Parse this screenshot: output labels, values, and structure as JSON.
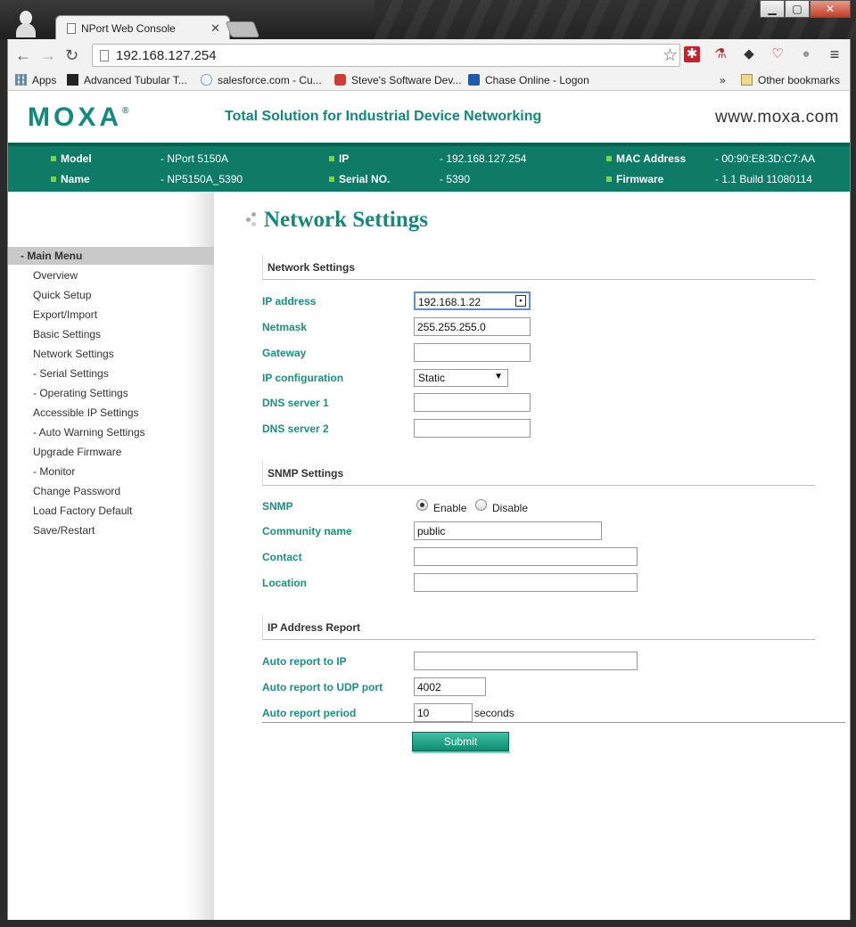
{
  "browser": {
    "tab_title": "NPort Web Console",
    "tab_close": "✕",
    "url": "192.168.127.254",
    "bookmarks": [
      {
        "label": "Apps"
      },
      {
        "label": "Advanced Tubular T..."
      },
      {
        "label": "salesforce.com - Cu..."
      },
      {
        "label": "Steve's Software Dev..."
      },
      {
        "label": "Chase Online - Logon"
      }
    ],
    "bookmarks_overflow": "»",
    "other_bookmarks": "Other bookmarks"
  },
  "header": {
    "logo": "MOXA",
    "tagline": "Total Solution for Industrial Device Networking",
    "site": "www.moxa.com"
  },
  "device_info": {
    "model_label": "Model",
    "model_value": "- NPort 5150A",
    "name_label": "Name",
    "name_value": "- NP5150A_5390",
    "ip_label": "IP",
    "ip_value": "- 192.168.127.254",
    "serial_label": "Serial NO.",
    "serial_value": "- 5390",
    "mac_label": "MAC Address",
    "mac_value": "- 00:90:E8:3D:C7:AA",
    "firmware_label": "Firmware",
    "firmware_value": "- 1.1 Build 11080114"
  },
  "sidebar": {
    "heading": "- Main Menu",
    "items": [
      {
        "label": "Overview"
      },
      {
        "label": "Quick Setup"
      },
      {
        "label": "Export/Import"
      },
      {
        "label": "Basic Settings"
      },
      {
        "label": "Network Settings"
      },
      {
        "label": "- Serial Settings"
      },
      {
        "label": "- Operating Settings"
      },
      {
        "label": "Accessible IP Settings"
      },
      {
        "label": "- Auto Warning Settings"
      },
      {
        "label": "Upgrade Firmware"
      },
      {
        "label": "- Monitor"
      },
      {
        "label": "Change Password"
      },
      {
        "label": "Load Factory Default"
      },
      {
        "label": "Save/Restart"
      }
    ]
  },
  "page_title": "Network Settings",
  "network": {
    "heading": "Network Settings",
    "ip_label": "IP address",
    "ip_value": "192.168.1.22",
    "netmask_label": "Netmask",
    "netmask_value": "255.255.255.0",
    "gateway_label": "Gateway",
    "gateway_value": "",
    "ipconf_label": "IP configuration",
    "ipconf_value": "Static",
    "dns1_label": "DNS server 1",
    "dns1_value": "",
    "dns2_label": "DNS server 2",
    "dns2_value": ""
  },
  "snmp": {
    "heading": "SNMP Settings",
    "snmp_label": "SNMP",
    "enable_label": "Enable",
    "disable_label": "Disable",
    "selected": "Enable",
    "community_label": "Community name",
    "community_value": "public",
    "contact_label": "Contact",
    "contact_value": "",
    "location_label": "Location",
    "location_value": ""
  },
  "report": {
    "heading": "IP Address Report",
    "auto_ip_label": "Auto report to IP",
    "auto_ip_value": "",
    "udp_label": "Auto report to UDP port",
    "udp_value": "4002",
    "period_label": "Auto report period",
    "period_value": "10",
    "period_unit": "seconds"
  },
  "submit_label": "Submit",
  "colors": {
    "brand": "#0f8c7b",
    "infobar": "#0e7b66",
    "field_label": "#17937e"
  }
}
